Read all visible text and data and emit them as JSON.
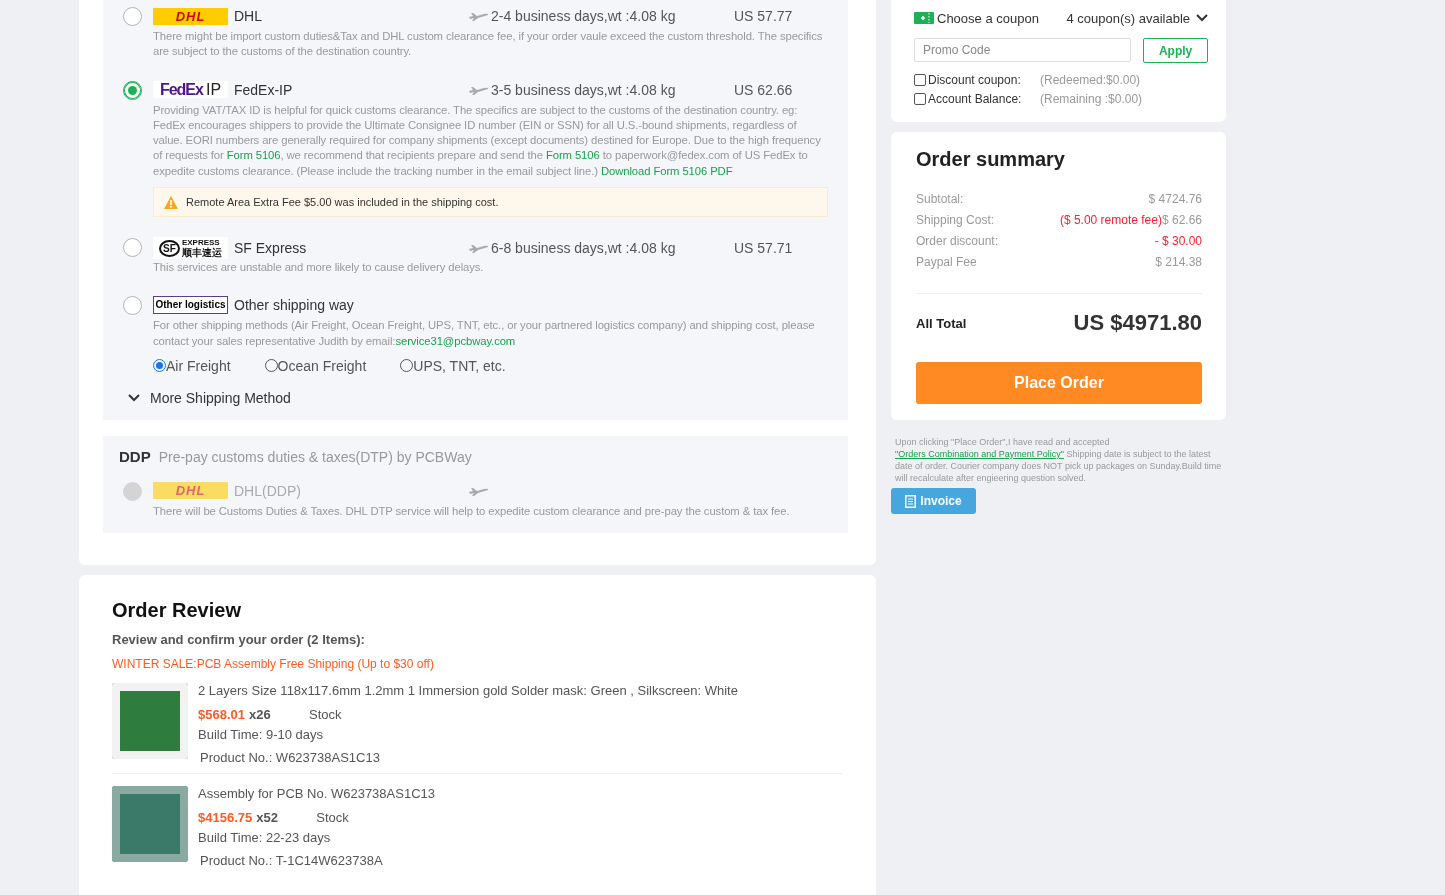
{
  "shipping": {
    "methods": [
      {
        "kind": "dhl",
        "logo_text": "DHL",
        "name": "DHL",
        "transit": "2-4 business days,wt :4.08 kg",
        "price": "US 57.77",
        "selected": false,
        "description": [
          {
            "kind": "text",
            "text": "There might be import custom duties&Tax and DHL custom clearance fee, if your order vaule exceed the custom threshold. The specifics are subject to the customs of the destination country."
          }
        ]
      },
      {
        "kind": "fedex",
        "logo_text": "FedEx",
        "logo_suffix": "IP",
        "name": "FedEx-IP",
        "transit": "3-5 business days,wt :4.08 kg",
        "price": "US 62.66",
        "selected": true,
        "description": [
          {
            "kind": "text",
            "text": "Providing VAT/TAX ID is helpful for quick customs clearance. The specifics are subject to the customs of the destination country. eg: FedEx encourages shippers to provide the Ultimate Consignee ID number (EIN or SSN) for all U.S.-bound shipments, regardless of value. EORI numbers are generally required for company shipments (except documents) destined for Europe. Due to the high frequency of requests for "
          },
          {
            "kind": "link",
            "text": "Form 5106"
          },
          {
            "kind": "text",
            "text": ", we recommend that recipients prepare and send the "
          },
          {
            "kind": "link",
            "text": "Form 5106"
          },
          {
            "kind": "text",
            "text": " to paperwork@fedex.com of US FedEx to expedite customs clearance. (Please include the tracking number in the email subject line.) "
          },
          {
            "kind": "link",
            "text": "Download Form 5106 PDF"
          }
        ],
        "notice": "Remote Area Extra Fee $5.00 was included in the shipping cost."
      },
      {
        "kind": "sf",
        "logo_text": "SF",
        "logo_suffix": "EXPRESS",
        "logo_sub": "顺丰速运",
        "name": "SF Express",
        "transit": "6-8 business days,wt :4.08 kg",
        "price": "US 57.71",
        "selected": false,
        "description": [
          {
            "kind": "text",
            "text": "This services are unstable and more likely to cause delivery delays."
          }
        ]
      },
      {
        "kind": "other",
        "logo_text": "Other logistics",
        "name": "Other shipping way",
        "selected": false,
        "description": [
          {
            "kind": "text",
            "text": "For other shipping methods (Air Freight, Ocean Freight, UPS, TNT, etc., or your partnered logistics company) and shipping cost, please contact your sales representative Judith by email:"
          },
          {
            "kind": "link",
            "text": "service31@pcbway.com"
          }
        ],
        "freight_options": [
          {
            "label": "Air Freight",
            "selected": true
          },
          {
            "label": "Ocean Freight",
            "selected": false
          },
          {
            "label": "UPS, TNT, etc.",
            "selected": false
          }
        ]
      }
    ],
    "more": "More Shipping Method"
  },
  "ddp": {
    "title": "DDP",
    "subtitle": "Pre-pay customs duties & taxes(DTP) by PCBWay",
    "methods": [
      {
        "kind": "dhl",
        "logo_text": "DHL",
        "name": "DHL(DDP)",
        "selected": false,
        "disabled": true,
        "description": [
          {
            "kind": "text",
            "text": "There will be Customs Duties & Taxes. DHL DTP service will help to expedite custom clearance and pre-pay the custom & tax fee."
          }
        ]
      }
    ]
  },
  "order_review": {
    "title": "Order Review",
    "subtitle": "Review and confirm your order (2 Items):",
    "promo": "WINTER SALE:PCB Assembly Free Shipping (Up to $30 off)",
    "items": [
      {
        "title": "2 Layers Size 118x117.6mm 1.2mm 1 Immersion gold Solder mask: Green , Silkscreen: White",
        "price": "$568.01",
        "qty": "x26",
        "stock": "Stock",
        "build_time": "Build Time: 9-10 days",
        "product_no": "Product No.: W623738AS1C13"
      },
      {
        "title": "Assembly for PCB No. W623738AS1C13",
        "price": "$4156.75",
        "qty": "x52",
        "stock": "Stock",
        "build_time": "Build Time: 22-23 days",
        "product_no": "Product No.: T-1C14W623738A"
      }
    ]
  },
  "coupon": {
    "label": "Choose a coupon",
    "available": "4 coupon(s) available",
    "placeholder": "Promo Code",
    "apply": "Apply",
    "options": [
      {
        "label": "Discount coupon:",
        "note": "(Redeemed:$0.00)",
        "checked": false
      },
      {
        "label": "Account Balance:",
        "note": "(Remaining :$0.00)",
        "checked": false
      }
    ]
  },
  "summary": {
    "title": "Order summary",
    "rows": [
      {
        "label": "Subtotal:",
        "value": "$ 4724.76",
        "highlight": false
      },
      {
        "label": "Shipping Cost:",
        "extra": "($ 5.00 remote fee)",
        "value": "$ 62.66",
        "highlight": false
      },
      {
        "label": "Order discount:",
        "value": "- $ 30.00",
        "highlight": true
      },
      {
        "label": "Paypal Fee",
        "value": "$ 214.38",
        "highlight": false
      }
    ],
    "total_label": "All Total",
    "total": "US $4971.80",
    "button": "Place Order"
  },
  "terms": {
    "before": "Upon clicking \"Place Order\",I have read and accepted ",
    "link": "\"Orders Combination and Payment Policy\"",
    "after": " Shipping date is subject to the latest date of order. Courier company does NOT pick up packages on Sunday.Build time will recalculate after engieering question solved."
  },
  "invoice": "Invoice"
}
